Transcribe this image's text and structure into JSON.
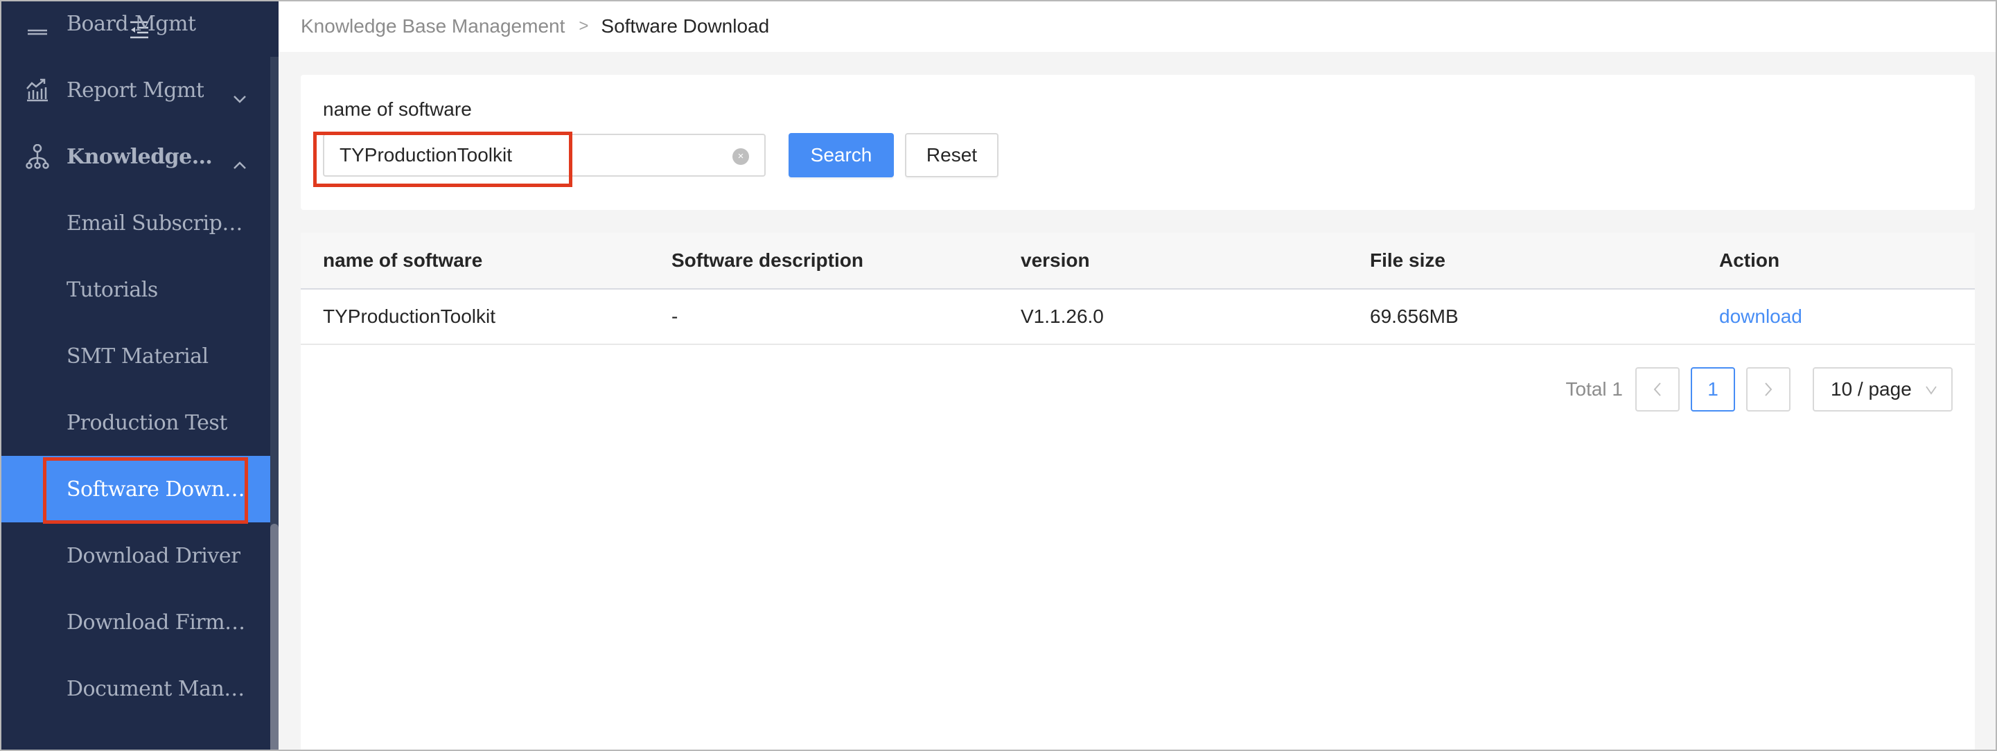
{
  "sidebar": {
    "collapse_icon": "menu-fold-icon",
    "items": [
      {
        "label": "Board Mgmt",
        "icon": "list-icon",
        "type": "parent",
        "state": "collapsed"
      },
      {
        "label": "Report Mgmt",
        "icon": "chart-trend-icon",
        "type": "parent",
        "state": "collapsed"
      },
      {
        "label": "Knowledge Base Management",
        "icon": "hierarchy-icon",
        "type": "parent",
        "state": "expanded"
      },
      {
        "label": "Email Subscription",
        "type": "child"
      },
      {
        "label": "Tutorials",
        "type": "child"
      },
      {
        "label": "SMT Material",
        "type": "child"
      },
      {
        "label": "Production Test",
        "type": "child"
      },
      {
        "label": "Software Download",
        "type": "child",
        "selected": true
      },
      {
        "label": "Download Driver",
        "type": "child"
      },
      {
        "label": "Download Firmware",
        "type": "child"
      },
      {
        "label": "Document Management",
        "type": "child"
      }
    ]
  },
  "breadcrumb": {
    "parent": "Knowledge Base Management",
    "separator": ">",
    "current": "Software Download"
  },
  "filter": {
    "label": "name of software",
    "value": "TYProductionToolkit",
    "clear_icon": "×",
    "search_label": "Search",
    "reset_label": "Reset"
  },
  "table": {
    "columns": [
      "name of software",
      "Software description",
      "version",
      "File size",
      "Action"
    ],
    "rows": [
      {
        "name": "TYProductionToolkit",
        "description": "-",
        "version": "V1.1.26.0",
        "size": "69.656MB",
        "action": "download"
      }
    ]
  },
  "pagination": {
    "total_label": "Total 1",
    "prev": "<",
    "current_page": "1",
    "next": ">",
    "page_size": "10 / page"
  },
  "colors": {
    "sidebar_bg": "#1f2b49",
    "accent": "#478df5",
    "highlight": "#e03a1e"
  }
}
